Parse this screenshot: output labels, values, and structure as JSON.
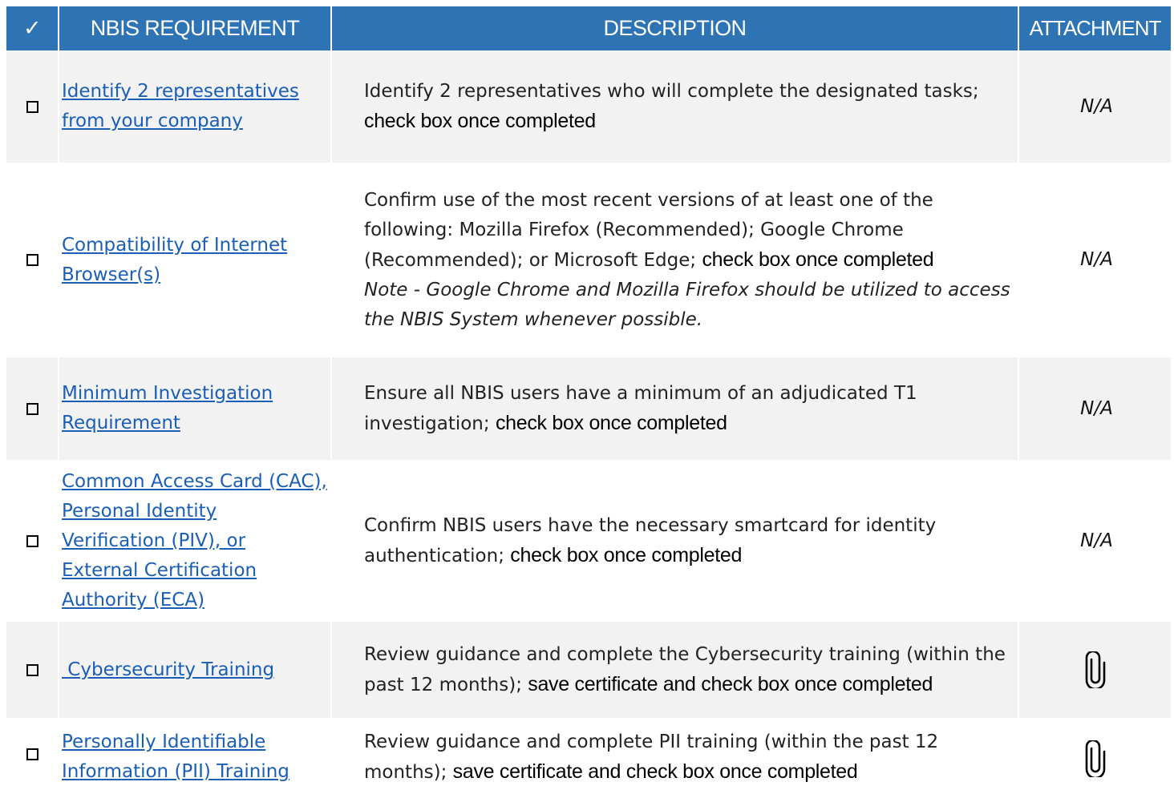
{
  "header": {
    "check": "✓",
    "requirement": "NBIS REQUIREMENT",
    "description": "DESCRIPTION",
    "attachment": "ATTACHMENT"
  },
  "rows": [
    {
      "requirement": [
        "Identify 2 representatives",
        "from your company"
      ],
      "description": "Identify 2 representatives who will complete the designated tasks;",
      "action": "check box once completed",
      "note": "",
      "attachment": "N/A"
    },
    {
      "requirement": [
        "Compatibility of Internet",
        "Browser(s)"
      ],
      "description": "Confirm use of the most recent versions of at least one of the following: Mozilla Firefox (Recommended); Google Chrome (Recommended); or Microsoft Edge;",
      "action": "check box once completed",
      "note": "Note - Google Chrome and Mozilla Firefox should be utilized to access the NBIS System whenever possible.",
      "attachment": "N/A"
    },
    {
      "requirement": [
        "Minimum Investigation",
        "Requirement"
      ],
      "description": "Ensure all NBIS users have a minimum of an adjudicated T1 investigation;",
      "action": "check box once completed",
      "note": "",
      "attachment": "N/A"
    },
    {
      "requirement": [
        "Common Access Card (CAC),",
        "Personal Identity",
        "Verification (PIV), or",
        "External Certification",
        "Authority (ECA)"
      ],
      "description": "Confirm NBIS users have the necessary smartcard for identity authentication;",
      "action": "check box once completed",
      "note": "",
      "attachment": "N/A"
    },
    {
      "requirement": [
        " Cybersecurity Training"
      ],
      "description": "Review guidance and complete the Cybersecurity training (within the past 12 months);",
      "action": "save certificate and check box once completed",
      "note": "",
      "attachment": "paperclip-icon"
    },
    {
      "requirement": [
        "Personally Identifiable",
        "Information (PII) Training"
      ],
      "description": "Review guidance and complete PII training (within the past 12 months);",
      "action": "save certificate and check box once completed",
      "note": "",
      "attachment": "paperclip-icon"
    }
  ]
}
